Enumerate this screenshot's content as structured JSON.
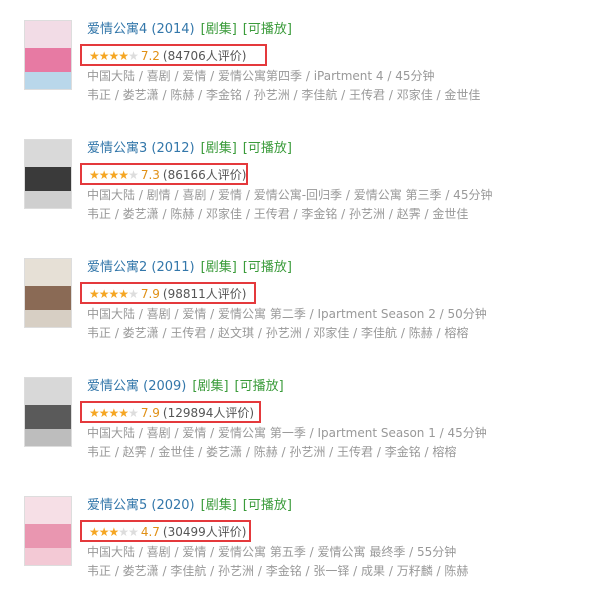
{
  "colors": {
    "title": "#3377aa",
    "tag": "#3a9b3a",
    "highlight_border": "#e4393c",
    "star": "#f5a623",
    "score": "#e09015"
  },
  "items": [
    {
      "title": "爱情公寓4 (2014)",
      "tag1": "[剧集]",
      "tag2": "[可播放]",
      "stars": 3.5,
      "score": "7.2",
      "count": "(84706人评价)",
      "meta1": "中国大陆 / 喜剧 / 爱情 / 爱情公寓第四季 / iPartment 4 / 45分钟",
      "meta2": "韦正 / 娄艺潇 / 陈赫 / 李金铭 / 孙艺洲 / 李佳航 / 王传君 / 邓家佳 / 金世佳"
    },
    {
      "title": "爱情公寓3 (2012)",
      "tag1": "[剧集]",
      "tag2": "[可播放]",
      "stars": 3.5,
      "score": "7.3",
      "count": "(86166人评价)",
      "meta1": "中国大陆 / 剧情 / 喜剧 / 爱情 / 爱情公寓-回归季 / 爱情公寓 第三季 / 45分钟",
      "meta2": "韦正 / 娄艺潇 / 陈赫 / 邓家佳 / 王传君 / 李金铭 / 孙艺洲 / 赵霁 / 金世佳"
    },
    {
      "title": "爱情公寓2 (2011)",
      "tag1": "[剧集]",
      "tag2": "[可播放]",
      "stars": 4,
      "score": "7.9",
      "count": "(98811人评价)",
      "meta1": "中国大陆 / 喜剧 / 爱情 / 爱情公寓 第二季 / Ipartment Season 2 / 50分钟",
      "meta2": "韦正 / 娄艺潇 / 王传君 / 赵文琪 / 孙艺洲 / 邓家佳 / 李佳航 / 陈赫 / 榕榕"
    },
    {
      "title": "爱情公寓 (2009)",
      "tag1": "[剧集]",
      "tag2": "[可播放]",
      "stars": 4,
      "score": "7.9",
      "count": "(129894人评价)",
      "meta1": "中国大陆 / 喜剧 / 爱情 / 爱情公寓 第一季 / Ipartment Season 1 / 45分钟",
      "meta2": "韦正 / 赵霁 / 金世佳 / 娄艺潇 / 陈赫 / 孙艺洲 / 王传君 / 李金铭 / 榕榕"
    },
    {
      "title": "爱情公寓5 (2020)",
      "tag1": "[剧集]",
      "tag2": "[可播放]",
      "stars": 2.5,
      "score": "4.7",
      "count": "(30499人评价)",
      "meta1": "中国大陆 / 喜剧 / 爱情 / 爱情公寓 第五季 / 爱情公寓 最终季 / 55分钟",
      "meta2": "韦正 / 娄艺潇 / 李佳航 / 孙艺洲 / 李金铭 / 张一铎 / 成果 / 万籽麟 / 陈赫"
    }
  ]
}
